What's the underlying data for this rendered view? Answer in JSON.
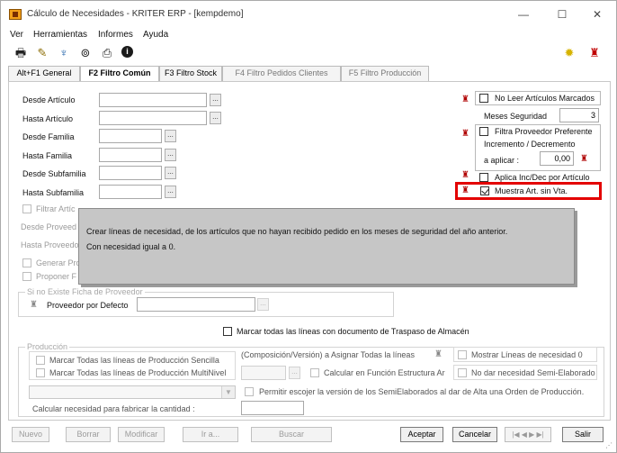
{
  "window": {
    "title": "Cálculo de Necesidades - KRITER ERP - [kempdemo]",
    "controls": {
      "minimize": "—",
      "maximize": "☐",
      "close": "✕"
    }
  },
  "menu": [
    "Ver",
    "Herramientas",
    "Informes",
    "Ayuda"
  ],
  "toolbar": {
    "icons": [
      "printer-icon",
      "pencil-icon",
      "tree-icon",
      "binoculars-icon",
      "print-preview-icon",
      "info-icon"
    ],
    "right_icons": [
      "lightbulb-icon",
      "pin-icon"
    ]
  },
  "tabs": [
    {
      "label": "Alt+F1 General",
      "state": "normal"
    },
    {
      "label": "F2 Filtro Común",
      "state": "active"
    },
    {
      "label": "F3 Filtro Stock",
      "state": "normal"
    },
    {
      "label": "F4 Filtro Pedidos Clientes",
      "state": "disabled"
    },
    {
      "label": "F5 Filtro Producción",
      "state": "disabled"
    }
  ],
  "fields": {
    "desde_articulo": {
      "label": "Desde Artículo",
      "value": ""
    },
    "hasta_articulo": {
      "label": "Hasta Artículo",
      "value": ""
    },
    "desde_familia": {
      "label": "Desde Familia",
      "value": ""
    },
    "hasta_familia": {
      "label": "Hasta Familia",
      "value": ""
    },
    "desde_subfamilia": {
      "label": "Desde Subfamilia",
      "value": ""
    },
    "hasta_subfamilia": {
      "label": "Hasta Subfamilia",
      "value": ""
    },
    "filtrar_articulos": "Filtrar Artíc",
    "desde_proveedor": "Desde Proveed",
    "hasta_proveedor": "Hasta Proveedo",
    "generar_pro": "Generar Pro",
    "proponer": "Proponer F"
  },
  "right_options": {
    "no_leer": "No Leer Artículos Marcados",
    "meses_seguridad_label": "Meses Seguridad",
    "meses_seguridad_value": "3",
    "filtra_proveedor": "Filtra Proveedor Preferente",
    "incremento_label": "Incremento / Decremento",
    "a_aplicar_label": "a aplicar :",
    "a_aplicar_value": "0,00",
    "aplica_inc_dec": "Aplica Inc/Dec por Artículo",
    "muestra_art": "Muestra Art. sin Vta."
  },
  "tooltip": {
    "line1": "Crear líneas de necesidad, de los artículos que no hayan recibido pedido en los meses de seguridad del año anterior.",
    "line2": "Con necesidad igual a 0."
  },
  "proveedor_group": {
    "title": "Si no Existe Ficha de Proveedor",
    "label": "Proveedor por Defecto"
  },
  "traspaso": "Marcar todas las líneas con documento de Traspaso de Almacén",
  "produccion": {
    "title": "Producción",
    "sencilla": "Marcar Todas las líneas de Producción Sencilla",
    "multinivel": "Marcar Todas las líneas de Producción MultiNivel",
    "composicion": "(Composición/Versión) a Asignar Todas la líneas",
    "mostrar_lineas": "Mostrar Líneas de necesidad 0",
    "calcular_estructura": "Calcular en Función Estructura Ar",
    "no_dar": "No dar necesidad Semi-Elaborado",
    "permitir": "Permitir escojer la versión de los SemiElaborados al dar de Alta una Orden de Producción.",
    "calcular_cantidad": "Calcular necesidad para fabricar la cantidad :"
  },
  "footer": {
    "nuevo": "Nuevo",
    "borrar": "Borrar",
    "modificar": "Modificar",
    "ir_a": "Ir a...",
    "buscar": "Buscar",
    "aceptar": "Aceptar",
    "cancelar": "Cancelar",
    "nav": "|◀ ◀ ▶ ▶|",
    "salir": "Salir"
  }
}
